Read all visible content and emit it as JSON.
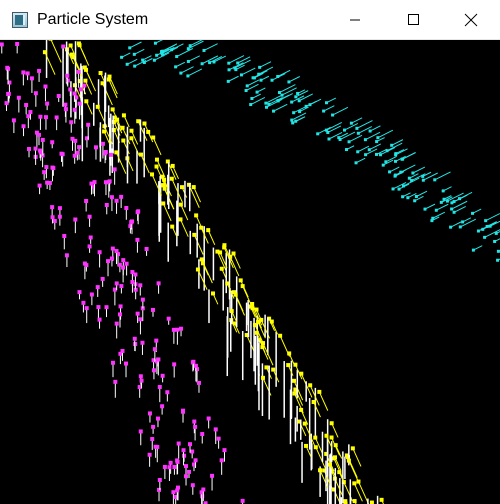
{
  "window": {
    "title": "Particle System"
  },
  "titlebar_buttons": {
    "minimize": "minimize-icon",
    "maximize": "maximize-icon",
    "close": "close-icon"
  },
  "colors": {
    "background": "#000000",
    "cyan": "#22e6e6",
    "yellow": "#ffff00",
    "magenta": "#ff33ff",
    "white": "#ffffff"
  }
}
